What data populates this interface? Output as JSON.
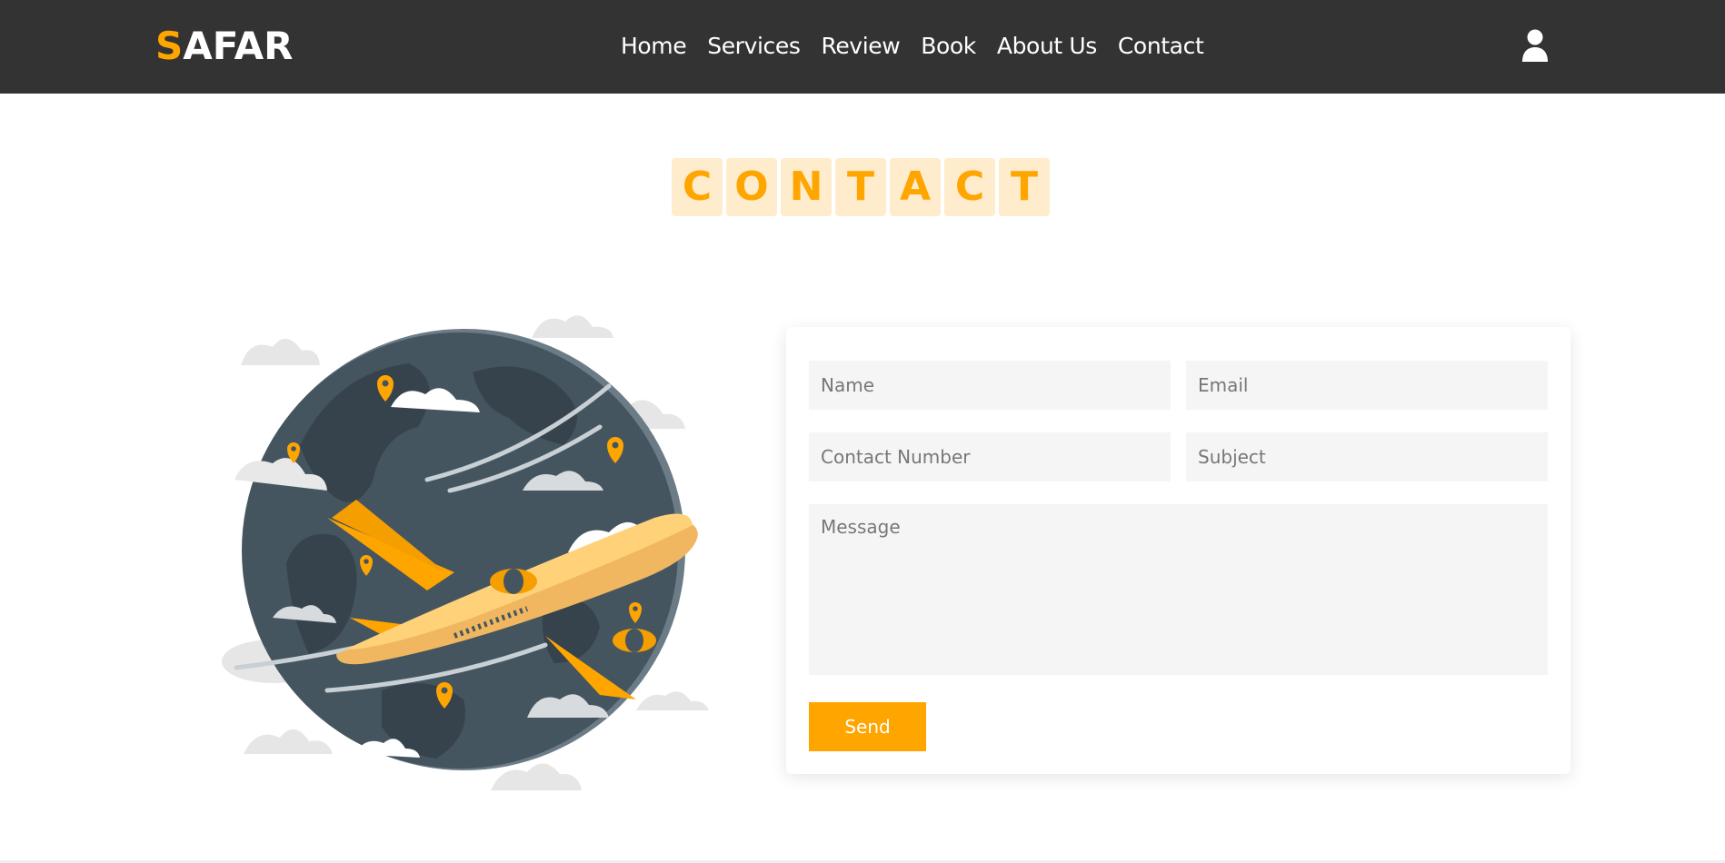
{
  "brand": {
    "logo_first": "S",
    "logo_rest": "AFAR",
    "accent_color": "#ffa500",
    "nav_bg": "#333333"
  },
  "nav": {
    "items": [
      {
        "label": "Home"
      },
      {
        "label": "Services"
      },
      {
        "label": "Review"
      },
      {
        "label": "Book"
      },
      {
        "label": "About Us"
      },
      {
        "label": "Contact"
      }
    ],
    "user_icon": "user-icon"
  },
  "contact": {
    "heading_letters": [
      "C",
      "O",
      "N",
      "T",
      "A",
      "C",
      "T"
    ],
    "illustration": "globe-airplane-illustration",
    "form": {
      "name_placeholder": "Name",
      "email_placeholder": "Email",
      "contact_placeholder": "Contact Number",
      "subject_placeholder": "Subject",
      "message_placeholder": "Message",
      "send_label": "Send"
    }
  }
}
